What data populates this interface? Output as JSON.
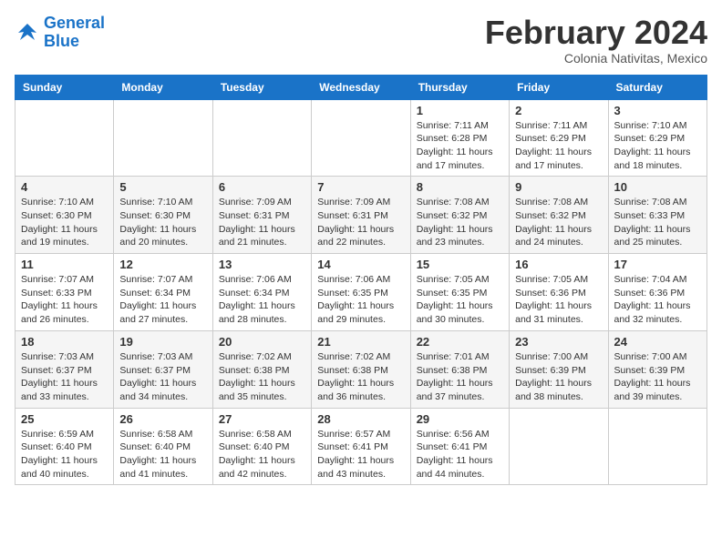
{
  "header": {
    "logo_line1": "General",
    "logo_line2": "Blue",
    "month": "February 2024",
    "location": "Colonia Nativitas, Mexico"
  },
  "weekdays": [
    "Sunday",
    "Monday",
    "Tuesday",
    "Wednesday",
    "Thursday",
    "Friday",
    "Saturday"
  ],
  "weeks": [
    [
      {
        "day": "",
        "info": ""
      },
      {
        "day": "",
        "info": ""
      },
      {
        "day": "",
        "info": ""
      },
      {
        "day": "",
        "info": ""
      },
      {
        "day": "1",
        "info": "Sunrise: 7:11 AM\nSunset: 6:28 PM\nDaylight: 11 hours and 17 minutes."
      },
      {
        "day": "2",
        "info": "Sunrise: 7:11 AM\nSunset: 6:29 PM\nDaylight: 11 hours and 17 minutes."
      },
      {
        "day": "3",
        "info": "Sunrise: 7:10 AM\nSunset: 6:29 PM\nDaylight: 11 hours and 18 minutes."
      }
    ],
    [
      {
        "day": "4",
        "info": "Sunrise: 7:10 AM\nSunset: 6:30 PM\nDaylight: 11 hours and 19 minutes."
      },
      {
        "day": "5",
        "info": "Sunrise: 7:10 AM\nSunset: 6:30 PM\nDaylight: 11 hours and 20 minutes."
      },
      {
        "day": "6",
        "info": "Sunrise: 7:09 AM\nSunset: 6:31 PM\nDaylight: 11 hours and 21 minutes."
      },
      {
        "day": "7",
        "info": "Sunrise: 7:09 AM\nSunset: 6:31 PM\nDaylight: 11 hours and 22 minutes."
      },
      {
        "day": "8",
        "info": "Sunrise: 7:08 AM\nSunset: 6:32 PM\nDaylight: 11 hours and 23 minutes."
      },
      {
        "day": "9",
        "info": "Sunrise: 7:08 AM\nSunset: 6:32 PM\nDaylight: 11 hours and 24 minutes."
      },
      {
        "day": "10",
        "info": "Sunrise: 7:08 AM\nSunset: 6:33 PM\nDaylight: 11 hours and 25 minutes."
      }
    ],
    [
      {
        "day": "11",
        "info": "Sunrise: 7:07 AM\nSunset: 6:33 PM\nDaylight: 11 hours and 26 minutes."
      },
      {
        "day": "12",
        "info": "Sunrise: 7:07 AM\nSunset: 6:34 PM\nDaylight: 11 hours and 27 minutes."
      },
      {
        "day": "13",
        "info": "Sunrise: 7:06 AM\nSunset: 6:34 PM\nDaylight: 11 hours and 28 minutes."
      },
      {
        "day": "14",
        "info": "Sunrise: 7:06 AM\nSunset: 6:35 PM\nDaylight: 11 hours and 29 minutes."
      },
      {
        "day": "15",
        "info": "Sunrise: 7:05 AM\nSunset: 6:35 PM\nDaylight: 11 hours and 30 minutes."
      },
      {
        "day": "16",
        "info": "Sunrise: 7:05 AM\nSunset: 6:36 PM\nDaylight: 11 hours and 31 minutes."
      },
      {
        "day": "17",
        "info": "Sunrise: 7:04 AM\nSunset: 6:36 PM\nDaylight: 11 hours and 32 minutes."
      }
    ],
    [
      {
        "day": "18",
        "info": "Sunrise: 7:03 AM\nSunset: 6:37 PM\nDaylight: 11 hours and 33 minutes."
      },
      {
        "day": "19",
        "info": "Sunrise: 7:03 AM\nSunset: 6:37 PM\nDaylight: 11 hours and 34 minutes."
      },
      {
        "day": "20",
        "info": "Sunrise: 7:02 AM\nSunset: 6:38 PM\nDaylight: 11 hours and 35 minutes."
      },
      {
        "day": "21",
        "info": "Sunrise: 7:02 AM\nSunset: 6:38 PM\nDaylight: 11 hours and 36 minutes."
      },
      {
        "day": "22",
        "info": "Sunrise: 7:01 AM\nSunset: 6:38 PM\nDaylight: 11 hours and 37 minutes."
      },
      {
        "day": "23",
        "info": "Sunrise: 7:00 AM\nSunset: 6:39 PM\nDaylight: 11 hours and 38 minutes."
      },
      {
        "day": "24",
        "info": "Sunrise: 7:00 AM\nSunset: 6:39 PM\nDaylight: 11 hours and 39 minutes."
      }
    ],
    [
      {
        "day": "25",
        "info": "Sunrise: 6:59 AM\nSunset: 6:40 PM\nDaylight: 11 hours and 40 minutes."
      },
      {
        "day": "26",
        "info": "Sunrise: 6:58 AM\nSunset: 6:40 PM\nDaylight: 11 hours and 41 minutes."
      },
      {
        "day": "27",
        "info": "Sunrise: 6:58 AM\nSunset: 6:40 PM\nDaylight: 11 hours and 42 minutes."
      },
      {
        "day": "28",
        "info": "Sunrise: 6:57 AM\nSunset: 6:41 PM\nDaylight: 11 hours and 43 minutes."
      },
      {
        "day": "29",
        "info": "Sunrise: 6:56 AM\nSunset: 6:41 PM\nDaylight: 11 hours and 44 minutes."
      },
      {
        "day": "",
        "info": ""
      },
      {
        "day": "",
        "info": ""
      }
    ]
  ]
}
